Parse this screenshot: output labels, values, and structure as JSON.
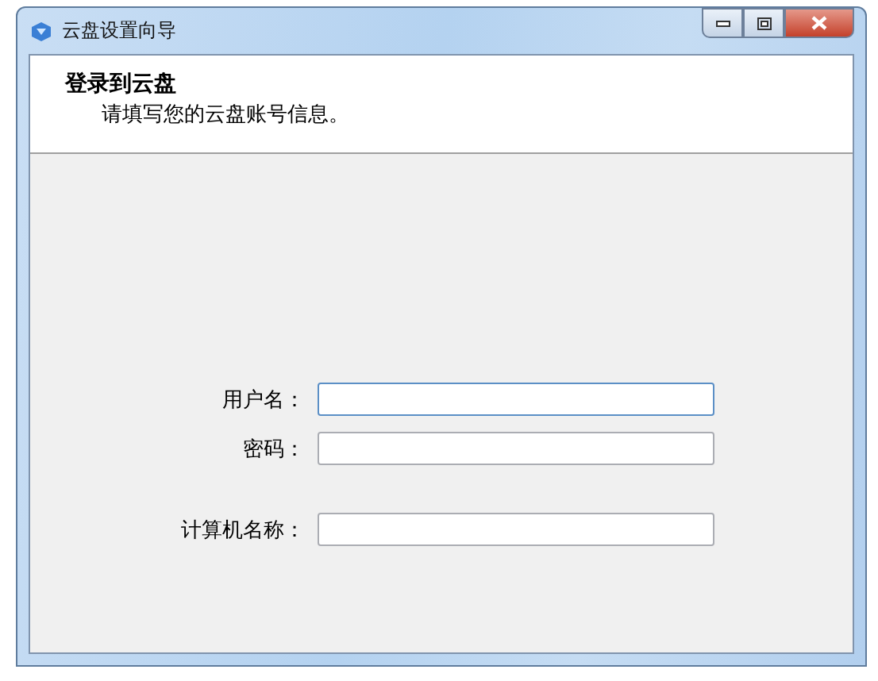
{
  "window": {
    "title": "云盘设置向导"
  },
  "header": {
    "title": "登录到云盘",
    "subtitle": "请填写您的云盘账号信息。"
  },
  "field_groups": [
    [
      {
        "label": "用户名：",
        "focused": true
      },
      {
        "label": "密码：",
        "focused": false
      }
    ],
    [
      {
        "label": "计算机名称：",
        "focused": false
      }
    ]
  ]
}
